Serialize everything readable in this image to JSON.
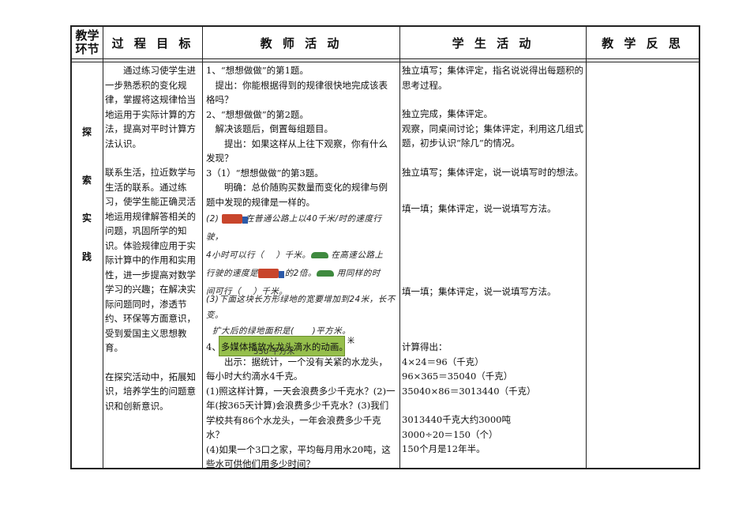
{
  "header": {
    "col_stage": "教学环节",
    "col_goal": "过 程 目 标",
    "col_teacher": "教 师 活 动",
    "col_student": "学 生 活 动",
    "col_reflection": "教 学 反 思"
  },
  "stage": [
    "探",
    "索",
    "实",
    "践"
  ],
  "goals": [
    "通过练习使学生进一步熟悉积的变化规律，掌握将这规律恰当地运用于实际计算的方法，提高对平时计算方法认识。",
    "联系生活，拉近数学与生活的联系。通过练习，使学生能正确灵活地运用规律解答相关的问题，巩固所学的知识。体验规律应用于实际计算中的作用和实用性，进一步提高对数学学习的兴趣；在解决实际问题同时，渗透节约、环保等方面意识，受到爱国主义思想教育。",
    "在探究活动中，拓展知识，培养学生的问题意识和创新意识。"
  ],
  "teacher": {
    "t1": "1、“想想做做”的第1题。",
    "t1_hint": "提出：你能根据得到的规律很快地完成该表格吗？",
    "t2": "2、“想想做做”的第2题。",
    "t2_note": "解决该题后，倒置每组题目。",
    "t2_hint": "提出：如果这样从上往下观察，你有什么发现？",
    "t3": "3（1）“想想做做”的第3题。",
    "t3_note": "明确：总价随购买数量而变化的规律与例题中发现的规律是一样的。",
    "p2_line1": "在普通公路上以40千米/时的速度行驶，",
    "p2_line2a": "4小时可以行（",
    "p2_line2b": "）千米。",
    "p2_line2c": "在高速公路上",
    "p2_line3a": "行驶的速度是",
    "p2_line3b": "的2倍。",
    "p2_line3c": "用同样的时",
    "p2_line4a": "间可行（",
    "p2_line4b": "）千米。",
    "p2_label": "(2)",
    "p3_line1": "(3)下面这块长方形绿地的宽要增加到24米，长不变。",
    "p3_line2": "扩大后的绿地面积是(",
    "p3_line2b": ")平方米。",
    "p3_field": "550 平方米",
    "p3_mi": "米",
    "t4": "4、多媒体播放水龙头滴水的动画。",
    "t4_note": "出示：据统计，一个没有关紧的水龙头，每小时大约滴水4千克。",
    "t4_q1": "(1)照这样计算，一天会浪费多少千克水？(2)一年(按365天计算)会浪费多少千克水？(3)我们学校共有86个水龙头，一年会浪费多少千克水？",
    "t4_q4": "(4)如果一个3口之家，平均每月用水20吨，这些水可供他们用多少时间？"
  },
  "student": {
    "s1": "独立填写；集体评定，指名说说得出每题积的思考过程。",
    "s2a": "独立完成，集体评定。",
    "s2b": "观察，同桌间讨论；集体评定，利用这几组式题，初步认识“除几”的情况。",
    "s3": "独立填写；集体评定，说一说填写时的想法。",
    "s4": "填一填；集体评定，说一说填写方法。",
    "s5": "填一填；集体评定，说一说填写方法。",
    "calc_title": "计算得出：",
    "calc1": "4×24＝96（千克）",
    "calc2": "96×365＝35040（千克）",
    "calc3": "35040×86＝3013440（千克）",
    "calc4": "3013440千克大约3000吨",
    "calc5": "3000÷20＝150（个）",
    "calc6": "150个月是12年半。"
  }
}
